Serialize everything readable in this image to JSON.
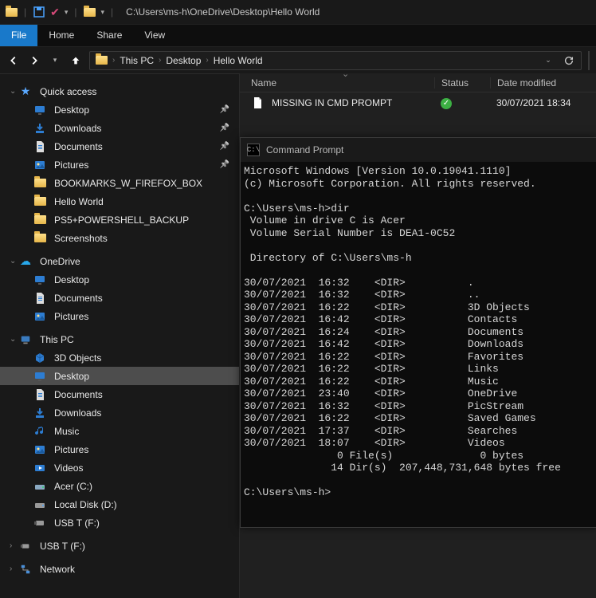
{
  "titlebar": {
    "path": "C:\\Users\\ms-h\\OneDrive\\Desktop\\Hello World"
  },
  "ribbon": {
    "file": "File",
    "home": "Home",
    "share": "Share",
    "view": "View"
  },
  "breadcrumb": {
    "root": "This PC",
    "mid": "Desktop",
    "leaf": "Hello World"
  },
  "columns": {
    "name": "Name",
    "status": "Status",
    "date": "Date modified"
  },
  "file_row": {
    "name": "MISSING IN CMD PROMPT",
    "date": "30/07/2021 18:34"
  },
  "sidebar": {
    "quick": "Quick access",
    "quick_items": [
      {
        "label": "Desktop",
        "icon": "desk",
        "pin": true
      },
      {
        "label": "Downloads",
        "icon": "dl",
        "pin": true
      },
      {
        "label": "Documents",
        "icon": "doc",
        "pin": true
      },
      {
        "label": "Pictures",
        "icon": "img",
        "pin": true
      },
      {
        "label": "BOOKMARKS_W_FIREFOX_BOX",
        "icon": "folder",
        "pin": false
      },
      {
        "label": "Hello World",
        "icon": "folder",
        "pin": false
      },
      {
        "label": "PS5+POWERSHELL_BACKUP",
        "icon": "folder",
        "pin": false
      },
      {
        "label": "Screenshots",
        "icon": "folder",
        "pin": false
      }
    ],
    "onedrive": "OneDrive",
    "onedrive_items": [
      {
        "label": "Desktop",
        "icon": "desk"
      },
      {
        "label": "Documents",
        "icon": "doc"
      },
      {
        "label": "Pictures",
        "icon": "img"
      }
    ],
    "thispc": "This PC",
    "pc_items": [
      {
        "label": "3D Objects",
        "icon": "3d"
      },
      {
        "label": "Desktop",
        "icon": "desk",
        "selected": true
      },
      {
        "label": "Documents",
        "icon": "doc"
      },
      {
        "label": "Downloads",
        "icon": "dl"
      },
      {
        "label": "Music",
        "icon": "music"
      },
      {
        "label": "Pictures",
        "icon": "img"
      },
      {
        "label": "Videos",
        "icon": "video"
      },
      {
        "label": "Acer (C:)",
        "icon": "drive"
      },
      {
        "label": "Local Disk (D:)",
        "icon": "disk"
      },
      {
        "label": "USB T (F:)",
        "icon": "usb"
      }
    ],
    "usb": "USB T (F:)",
    "network": "Network"
  },
  "cmd": {
    "title": "Command Prompt",
    "lines": [
      "Microsoft Windows [Version 10.0.19041.1110]",
      "(c) Microsoft Corporation. All rights reserved.",
      "",
      "C:\\Users\\ms-h>dir",
      " Volume in drive C is Acer",
      " Volume Serial Number is DEA1-0C52",
      "",
      " Directory of C:\\Users\\ms-h",
      "",
      "30/07/2021  16:32    <DIR>          .",
      "30/07/2021  16:32    <DIR>          ..",
      "30/07/2021  16:22    <DIR>          3D Objects",
      "30/07/2021  16:42    <DIR>          Contacts",
      "30/07/2021  16:24    <DIR>          Documents",
      "30/07/2021  16:42    <DIR>          Downloads",
      "30/07/2021  16:22    <DIR>          Favorites",
      "30/07/2021  16:22    <DIR>          Links",
      "30/07/2021  16:22    <DIR>          Music",
      "30/07/2021  23:40    <DIR>          OneDrive",
      "30/07/2021  16:32    <DIR>          PicStream",
      "30/07/2021  16:22    <DIR>          Saved Games",
      "30/07/2021  17:37    <DIR>          Searches",
      "30/07/2021  18:07    <DIR>          Videos",
      "               0 File(s)              0 bytes",
      "              14 Dir(s)  207,448,731,648 bytes free",
      "",
      "C:\\Users\\ms-h>"
    ]
  }
}
